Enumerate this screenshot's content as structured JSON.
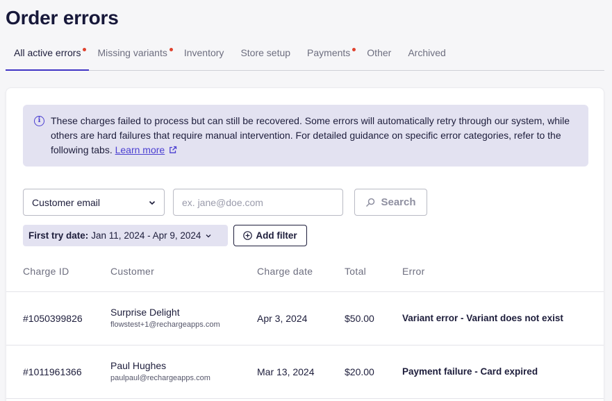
{
  "page": {
    "title": "Order errors"
  },
  "tabs": [
    {
      "label": "All active errors",
      "active": true,
      "has_dot": true
    },
    {
      "label": "Missing variants",
      "active": false,
      "has_dot": true
    },
    {
      "label": "Inventory",
      "active": false,
      "has_dot": false
    },
    {
      "label": "Store setup",
      "active": false,
      "has_dot": false
    },
    {
      "label": "Payments",
      "active": false,
      "has_dot": true
    },
    {
      "label": "Other",
      "active": false,
      "has_dot": false
    },
    {
      "label": "Archived",
      "active": false,
      "has_dot": false
    }
  ],
  "banner": {
    "text": "These charges failed to process but can still be recovered. Some errors will automatically retry through our system, while others are hard failures that require manual intervention. For detailed guidance on specific error categories, refer to the following tabs.",
    "link_label": "Learn more",
    "icon": "info-icon"
  },
  "filters": {
    "search_by_selected": "Customer email",
    "email_placeholder": "ex. jane@doe.com",
    "email_value": "",
    "search_label": "Search",
    "date_chip_label": "First try date:",
    "date_chip_value": "Jan 11, 2024 - Apr 9, 2024",
    "add_filter_label": "Add filter"
  },
  "table": {
    "columns": [
      "Charge ID",
      "Customer",
      "Charge date",
      "Total",
      "Error"
    ],
    "rows": [
      {
        "charge_id": "#1050399826",
        "customer_name": "Surprise Delight",
        "customer_email": "flowstest+1@rechargeapps.com",
        "charge_date": "Apr 3, 2024",
        "total": "$50.00",
        "error": "Variant error - Variant does not exist"
      },
      {
        "charge_id": "#1011961366",
        "customer_name": "Paul Hughes",
        "customer_email": "paulpaul@rechargeapps.com",
        "charge_date": "Mar 13, 2024",
        "total": "$20.00",
        "error": "Payment failure - Card expired"
      }
    ]
  },
  "colors": {
    "accent": "#3f33c4",
    "tab_dot": "#e0432f",
    "banner_bg": "#e3e2f1",
    "title": "#17183a"
  }
}
